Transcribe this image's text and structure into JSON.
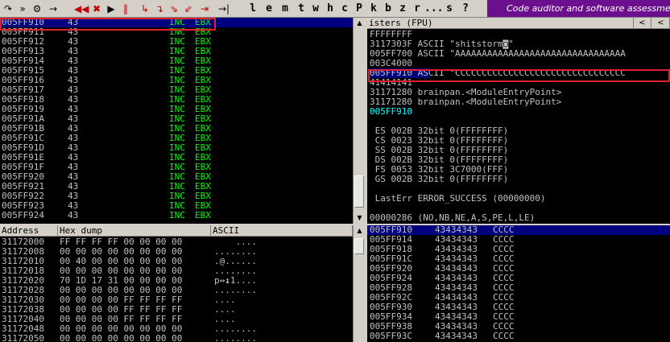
{
  "toolbar": {
    "icons": [
      "step-over-icon",
      "animate-icon",
      "debug-run-icon",
      "arrow-icon",
      "back-icon",
      "forward-icon",
      "play-icon",
      "pause-icon",
      "step-into-icon",
      "step-over2-icon",
      "trace-into-icon",
      "trace-over-icon",
      "execute-till-return-icon",
      "go-to-icon"
    ],
    "glyphs": [
      "↷",
      "»",
      "⚙",
      "→",
      "◀◀",
      "✖",
      "▶",
      "‖",
      "↳",
      "↴",
      "⇘",
      "⇙",
      "⇥",
      "→|"
    ],
    "letters": [
      "l",
      "e",
      "m",
      "t",
      "w",
      "h",
      "c",
      "P",
      "k",
      "b",
      "z",
      "r",
      "...",
      "s",
      "?"
    ],
    "promo_text": "Code auditor and software assessment specialist"
  },
  "disasm": {
    "rows": [
      {
        "addr": "005FF910",
        "hex": "43",
        "op": "INC",
        "arg": "EBX"
      },
      {
        "addr": "005FF911",
        "hex": "43",
        "op": "INC",
        "arg": "EBX"
      },
      {
        "addr": "005FF912",
        "hex": "43",
        "op": "INC",
        "arg": "EBX"
      },
      {
        "addr": "005FF913",
        "hex": "43",
        "op": "INC",
        "arg": "EBX"
      },
      {
        "addr": "005FF914",
        "hex": "43",
        "op": "INC",
        "arg": "EBX"
      },
      {
        "addr": "005FF915",
        "hex": "43",
        "op": "INC",
        "arg": "EBX"
      },
      {
        "addr": "005FF916",
        "hex": "43",
        "op": "INC",
        "arg": "EBX"
      },
      {
        "addr": "005FF917",
        "hex": "43",
        "op": "INC",
        "arg": "EBX"
      },
      {
        "addr": "005FF918",
        "hex": "43",
        "op": "INC",
        "arg": "EBX"
      },
      {
        "addr": "005FF919",
        "hex": "43",
        "op": "INC",
        "arg": "EBX"
      },
      {
        "addr": "005FF91A",
        "hex": "43",
        "op": "INC",
        "arg": "EBX"
      },
      {
        "addr": "005FF91B",
        "hex": "43",
        "op": "INC",
        "arg": "EBX"
      },
      {
        "addr": "005FF91C",
        "hex": "43",
        "op": "INC",
        "arg": "EBX"
      },
      {
        "addr": "005FF91D",
        "hex": "43",
        "op": "INC",
        "arg": "EBX"
      },
      {
        "addr": "005FF91E",
        "hex": "43",
        "op": "INC",
        "arg": "EBX"
      },
      {
        "addr": "005FF91F",
        "hex": "43",
        "op": "INC",
        "arg": "EBX"
      },
      {
        "addr": "005FF920",
        "hex": "43",
        "op": "INC",
        "arg": "EBX"
      },
      {
        "addr": "005FF921",
        "hex": "43",
        "op": "INC",
        "arg": "EBX"
      },
      {
        "addr": "005FF922",
        "hex": "43",
        "op": "INC",
        "arg": "EBX"
      },
      {
        "addr": "005FF923",
        "hex": "43",
        "op": "INC",
        "arg": "EBX"
      },
      {
        "addr": "005FF924",
        "hex": "43",
        "op": "INC",
        "arg": "EBX"
      }
    ]
  },
  "registers": {
    "header_title": "isters (FPU)",
    "lines": [
      {
        "text": "FFFFFFFF",
        "color": "w"
      },
      {
        "text": "3117303F ASCII \"shitstorm◙\"",
        "color": "w"
      },
      {
        "text": "005FF700 ASCII \"AAAAAAAAAAAAAAAAAAAAAAAAAAAAAAAA",
        "color": "w"
      },
      {
        "text": "003C4000",
        "color": "w"
      },
      {
        "text": "005FF910 ASCII \"CCCCCCCCCCCCCCCCCCCCCCCCCCCCCCCC",
        "color": "w"
      },
      {
        "text": "41414141",
        "color": "w"
      },
      {
        "text": "31171280 brainpan.<ModuleEntryPoint>",
        "color": "w"
      },
      {
        "text": "31171280 brainpan.<ModuleEntryPoint>",
        "color": "w"
      },
      {
        "text": "005FF910",
        "color": "cyan"
      },
      {
        "text": "",
        "color": "w"
      },
      {
        "text": " ES 002B 32bit 0(FFFFFFFF)",
        "color": "w"
      },
      {
        "text": " CS 0023 32bit 0(FFFFFFFF)",
        "color": "w"
      },
      {
        "text": " SS 002B 32bit 0(FFFFFFFF)",
        "color": "w"
      },
      {
        "text": " DS 002B 32bit 0(FFFFFFFF)",
        "color": "w"
      },
      {
        "text": " FS 0053 32bit 3C7000(FFF)",
        "color": "w"
      },
      {
        "text": " GS 002B 32bit 0(FFFFFFFF)",
        "color": "w"
      },
      {
        "text": "",
        "color": "w"
      },
      {
        "text": " LastErr ERROR_SUCCESS (00000000)",
        "color": "w"
      },
      {
        "text": "",
        "color": "w"
      },
      {
        "text": "00000286 (NO,NB,NE,A,S,PE,L,LE)",
        "color": "w"
      }
    ]
  },
  "dump": {
    "headers": {
      "address": "Address",
      "hex": "Hex dump",
      "ascii": "ASCII"
    },
    "rows": [
      {
        "addr": "31172000",
        "hex": "FF FF FF FF 00 00 00 00",
        "ascii": "    ...."
      },
      {
        "addr": "31172008",
        "hex": "00 00 00 00 00 00 00 00",
        "ascii": "........"
      },
      {
        "addr": "31172010",
        "hex": "00 40 00 00 00 00 00 00",
        "ascii": ".@......"
      },
      {
        "addr": "31172018",
        "hex": "00 00 00 00 00 00 00 00",
        "ascii": "........"
      },
      {
        "addr": "31172020",
        "hex": "70 1D 17 31 00 00 00 00",
        "ascii": "p↔↨1...."
      },
      {
        "addr": "31172028",
        "hex": "00 00 00 00 00 00 00 00",
        "ascii": "........"
      },
      {
        "addr": "31172030",
        "hex": "00 00 00 00 FF FF FF FF",
        "ascii": "....    "
      },
      {
        "addr": "31172038",
        "hex": "00 00 00 00 FF FF FF FF",
        "ascii": "....    "
      },
      {
        "addr": "31172040",
        "hex": "00 00 00 00 FF FF FF FF",
        "ascii": "....    "
      },
      {
        "addr": "31172048",
        "hex": "00 00 00 00 00 00 00 00",
        "ascii": "........"
      },
      {
        "addr": "31172050",
        "hex": "00 00 00 00 00 00 00 00",
        "ascii": "........"
      }
    ]
  },
  "stack": {
    "rows": [
      {
        "addr": "005FF910",
        "val": "43434343",
        "ascii": "CCCC"
      },
      {
        "addr": "005FF914",
        "val": "43434343",
        "ascii": "CCCC"
      },
      {
        "addr": "005FF918",
        "val": "43434343",
        "ascii": "CCCC"
      },
      {
        "addr": "005FF91C",
        "val": "43434343",
        "ascii": "CCCC"
      },
      {
        "addr": "005FF920",
        "val": "43434343",
        "ascii": "CCCC"
      },
      {
        "addr": "005FF924",
        "val": "43434343",
        "ascii": "CCCC"
      },
      {
        "addr": "005FF928",
        "val": "43434343",
        "ascii": "CCCC"
      },
      {
        "addr": "005FF92C",
        "val": "43434343",
        "ascii": "CCCC"
      },
      {
        "addr": "005FF930",
        "val": "43434343",
        "ascii": "CCCC"
      },
      {
        "addr": "005FF934",
        "val": "43434343",
        "ascii": "CCCC"
      },
      {
        "addr": "005FF938",
        "val": "43434343",
        "ascii": "CCCC"
      },
      {
        "addr": "005FF93C",
        "val": "43434343",
        "ascii": "CCCC"
      }
    ]
  },
  "colors": {
    "selection": "#00007f",
    "highlight_box": "#e0202c",
    "promo_bg": "#6b0f8e",
    "mnemonic": "#00ff00",
    "register_cyan": "#00ffff"
  }
}
